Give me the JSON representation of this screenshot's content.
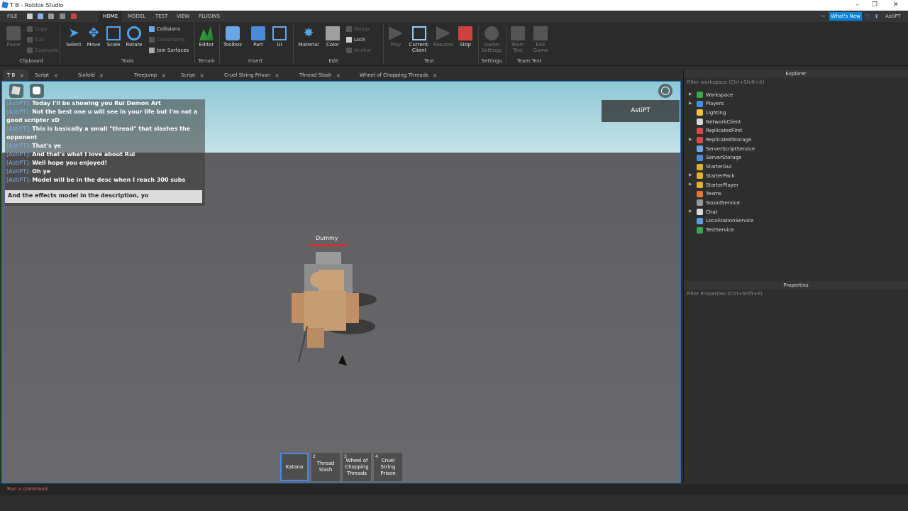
{
  "title": "T B - Roblox Studio",
  "menu": {
    "file": "FILE",
    "tabs": [
      "HOME",
      "MODEL",
      "TEST",
      "VIEW",
      "PLUGINS"
    ],
    "whats_new": "What's New",
    "user": "AstiPT"
  },
  "ribbon": {
    "clipboard": {
      "paste": "Paste",
      "copy": "Copy",
      "cut": "Cut",
      "duplicate": "Duplicate",
      "label": "Clipboard"
    },
    "tools": {
      "select": "Select",
      "move": "Move",
      "scale": "Scale",
      "rotate": "Rotate",
      "collisions": "Collisions",
      "constraints": "Constraints",
      "join": "Join Surfaces",
      "label": "Tools"
    },
    "terrain": {
      "editor": "Editor",
      "label": "Terrain"
    },
    "insert": {
      "toolbox": "Toolbox",
      "part": "Part",
      "ui": "UI",
      "label": "Insert"
    },
    "edit": {
      "material": "Material",
      "color": "Color",
      "group": "Group",
      "lock": "Lock",
      "anchor": "Anchor",
      "label": "Edit"
    },
    "test": {
      "play": "Play",
      "current_client": "Current: Client",
      "resume": "Resume",
      "stop": "Stop",
      "label": "Test"
    },
    "settings": {
      "game_settings": "Game Settings",
      "label": "Settings"
    },
    "team_test": {
      "team_test": "Team Test",
      "exit_game": "Exit Game",
      "label": "Team Test"
    }
  },
  "doc_tabs": [
    "T B",
    "Script",
    "Sixfold",
    "TreeJump",
    "Script",
    "Cruel String Prison",
    "Thread Slash",
    "Wheel of Chopping Threads"
  ],
  "chat": {
    "user_prefix": "[AstiPT]:",
    "lines": [
      "Today I'll be showing you Rui Demon Art",
      "Not the best one u will see in your life but I'm not a",
      "good scripter xD",
      "This is basically a small \"thread\" that slashes the",
      "opponent",
      "That's ye",
      "And that's what I love about Rui",
      "Well hope you enjoyed!",
      "Oh ye",
      "Model will be in the desc when I reach 300 subs"
    ],
    "input": "And the effects model in the description, yo"
  },
  "player_panel": "AstiPT",
  "dummy_label": "Dummy",
  "hotbar": [
    {
      "n": "",
      "label": "Katana"
    },
    {
      "n": "2",
      "label": "Thread Slash"
    },
    {
      "n": "3",
      "label": "Wheel of Chopping Threads"
    },
    {
      "n": "4",
      "label": "Cruel String Prison"
    }
  ],
  "explorer": {
    "title": "Explorer",
    "filter": "Filter workspace (Ctrl+Shift+X)",
    "items": [
      {
        "name": "Workspace",
        "color": "#3aa84a",
        "arrow": true
      },
      {
        "name": "Players",
        "color": "#3f8ee0",
        "arrow": true
      },
      {
        "name": "Lighting",
        "color": "#f2c230",
        "arrow": false
      },
      {
        "name": "NetworkClient",
        "color": "#d8d8d8",
        "arrow": false
      },
      {
        "name": "ReplicatedFirst",
        "color": "#d64a4a",
        "arrow": false
      },
      {
        "name": "ReplicatedStorage",
        "color": "#d64a4a",
        "arrow": true
      },
      {
        "name": "ServerScriptService",
        "color": "#6ba6e8",
        "arrow": false
      },
      {
        "name": "ServerStorage",
        "color": "#4a8ad6",
        "arrow": false
      },
      {
        "name": "StarterGui",
        "color": "#e0b030",
        "arrow": false
      },
      {
        "name": "StarterPack",
        "color": "#e0b030",
        "arrow": true
      },
      {
        "name": "StarterPlayer",
        "color": "#e0b030",
        "arrow": true
      },
      {
        "name": "Teams",
        "color": "#e07a30",
        "arrow": false
      },
      {
        "name": "SoundService",
        "color": "#9a9a9a",
        "arrow": false
      },
      {
        "name": "Chat",
        "color": "#d8d8d8",
        "arrow": true
      },
      {
        "name": "LocalizationService",
        "color": "#5aa0e0",
        "arrow": false
      },
      {
        "name": "TestService",
        "color": "#3aa84a",
        "arrow": false
      }
    ]
  },
  "properties": {
    "title": "Properties",
    "filter": "Filter Properties (Ctrl+Shift+P)"
  },
  "command_bar": "Run a command"
}
